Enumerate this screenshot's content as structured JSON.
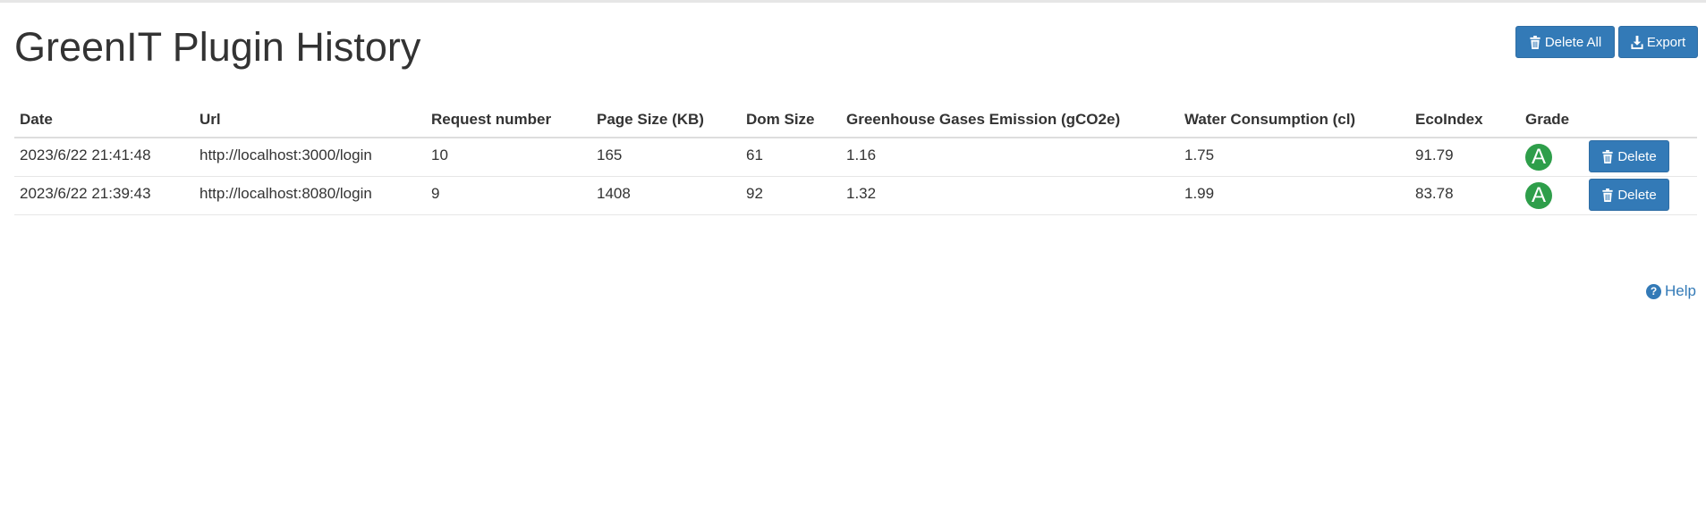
{
  "page": {
    "title": "GreenIT Plugin History"
  },
  "toolbar": {
    "delete_all_label": "Delete All",
    "export_label": "Export",
    "button_color": "#337ab7"
  },
  "table": {
    "columns": [
      "Date",
      "Url",
      "Request number",
      "Page Size (KB)",
      "Dom Size",
      "Greenhouse Gases Emission (gCO2e)",
      "Water Consumption (cl)",
      "EcoIndex",
      "Grade",
      ""
    ],
    "rows": [
      {
        "date": "2023/6/22 21:41:48",
        "url": "http://localhost:3000/login",
        "requests": "10",
        "page_size": "165",
        "dom_size": "61",
        "ghg": "1.16",
        "water": "1.75",
        "ecoindex": "91.79",
        "grade": "A",
        "grade_color": "#2e9e4a",
        "delete_label": "Delete"
      },
      {
        "date": "2023/6/22 21:39:43",
        "url": "http://localhost:8080/login",
        "requests": "9",
        "page_size": "1408",
        "dom_size": "92",
        "ghg": "1.32",
        "water": "1.99",
        "ecoindex": "83.78",
        "grade": "A",
        "grade_color": "#2e9e4a",
        "delete_label": "Delete"
      }
    ]
  },
  "help": {
    "label": "Help",
    "icon": "question-circle-icon"
  }
}
